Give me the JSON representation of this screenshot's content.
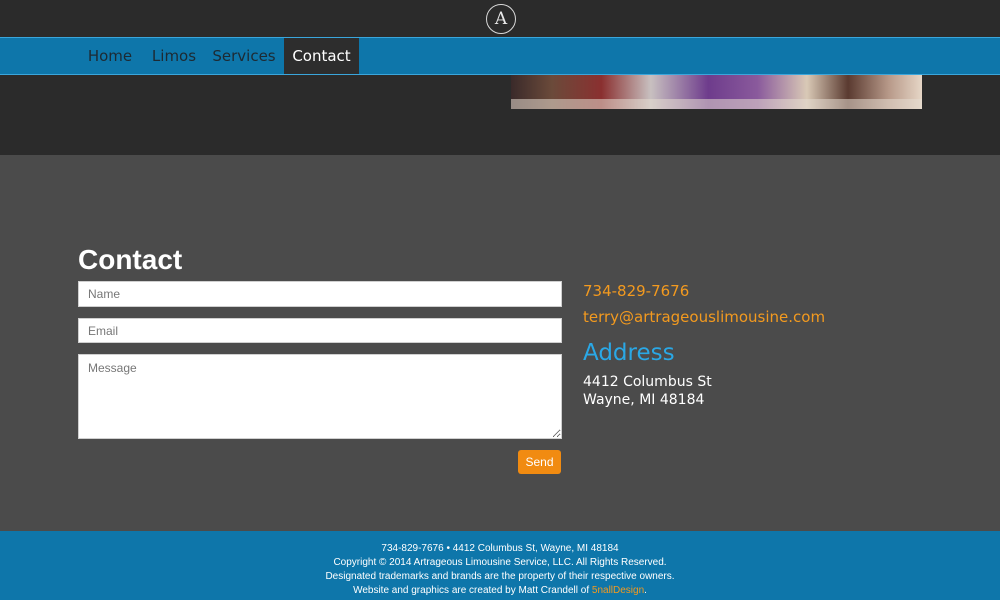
{
  "header": {
    "logo_icon": "artrageous-a-monogram-icon",
    "logo_glyph": "A"
  },
  "nav": {
    "items": [
      {
        "label": "Home"
      },
      {
        "label": "Limos"
      },
      {
        "label": "Services"
      },
      {
        "label": "Contact",
        "active": true
      }
    ]
  },
  "contact": {
    "heading": "Contact",
    "name_placeholder": "Name",
    "email_placeholder": "Email",
    "message_placeholder": "Message",
    "send_label": "Send"
  },
  "info": {
    "phone": "734-829-7676",
    "email": "terry@artrageouslimousine.com",
    "address_title": "Address",
    "address_line1": "4412 Columbus St",
    "address_line2": "Wayne, MI 48184"
  },
  "footer": {
    "line1": "734-829-7676 • 4412 Columbus St, Wayne, MI 48184",
    "line2": "Copyright © 2014 Artrageous Limousine Service, LLC. All Rights Reserved.",
    "line3": "Designated trademarks and brands are the property of their respective owners.",
    "line4_prefix": "Website and graphics are created by Matt Crandell of ",
    "line4_link": "5nallDesign",
    "line4_suffix": "."
  },
  "colors": {
    "nav_blue": "#0e76aa",
    "accent_orange": "#f18b11",
    "address_blue": "#2aa8e6",
    "dark_bg": "#2b2b2b",
    "content_bg": "#4b4b4b"
  }
}
